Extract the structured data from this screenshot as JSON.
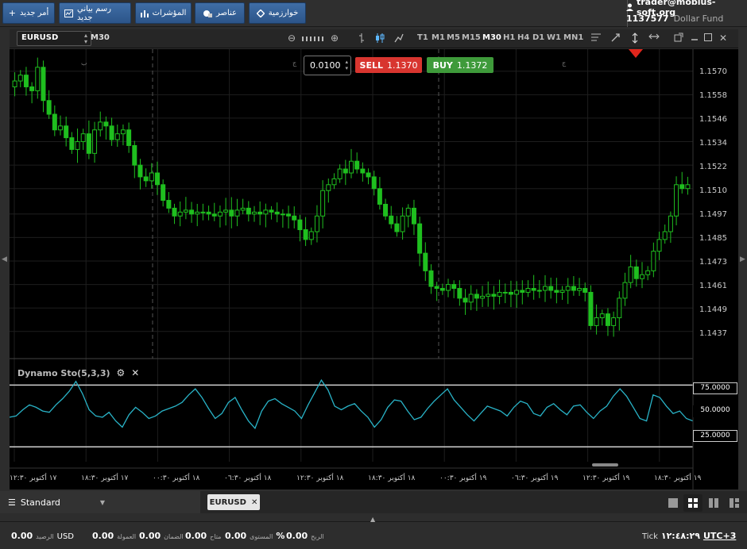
{
  "toolbar": {
    "new_order": "أمر جديد",
    "new_chart": "رسم بياني جديد",
    "indicators": "المؤشرات",
    "elements": "عناصر",
    "algorithm": "خوارزمية"
  },
  "account": {
    "user": "trader@mobius-soft.org",
    "number": "1137577",
    "fund": "Dollar Fund"
  },
  "chart_toolbar": {
    "symbol": "EURUSD",
    "timeframe": "M30",
    "timeframes": [
      "T1",
      "M1",
      "M5",
      "M15",
      "M30",
      "H1",
      "H4",
      "D1",
      "W1",
      "MN1"
    ],
    "active_timeframe": "M30"
  },
  "trade": {
    "lot": "0.0100",
    "sell_label": "SELL",
    "sell_price": "1.1370",
    "buy_label": "BUY",
    "buy_price": "1.1372"
  },
  "indicator": {
    "name": "Dynamo Sto(5,3,3)"
  },
  "price_axis": [
    "1.1570",
    "1.1558",
    "1.1546",
    "1.1534",
    "1.1522",
    "1.1510",
    "1.1497",
    "1.1485",
    "1.1473",
    "1.1461",
    "1.1449",
    "1.1437"
  ],
  "stoch_axis": [
    "75.0000",
    "50.0000",
    "25.0000"
  ],
  "session_markers": [
    "ب",
    "ج",
    "ج"
  ],
  "date_axis": [
    "١٧ أكتوبر ١٢:٣٠",
    "١٧ أكتوبر ١٨:٣٠",
    "١٨ أكتوبر ٠٠:٣٠",
    "١٨ أكتوبر ٠٦:٣٠",
    "١٨ أكتوبر ١٢:٣٠",
    "١٨ أكتوبر ١٨:٣٠",
    "١٩ أكتوبر ٠٠:٣٠",
    "١٩ أكتوبر ٠٦:٣٠",
    "١٩ أكتوبر ١٢:٣٠",
    "١٩ أكتوبر ١٨:٣٠"
  ],
  "bottom_tabs": {
    "template": "Standard",
    "chart_tab": "EURUSD"
  },
  "status": {
    "balance_value": "0.00",
    "balance_currency": "USD",
    "balance_label": "الرصيد",
    "commission_value": "0.00",
    "commission_label": "العمولة",
    "margin_value": "0.00",
    "margin_label": "الضمان",
    "available_value": "0.00",
    "available_label": "متاح",
    "level_value": "%",
    "level_label": "المستوى",
    "profit_value": "0.00",
    "profit_label": "الربح",
    "tick_label": "Tick",
    "time": "١٢:٤٨:٢٩",
    "timezone": "UTC+3"
  },
  "chart_data": {
    "type": "candlestick",
    "symbol": "EURUSD",
    "timeframe": "M30",
    "ylim": [
      1.1428,
      1.1578
    ],
    "closes": [
      1.1565,
      1.1568,
      1.1562,
      1.156,
      1.1572,
      1.1555,
      1.1548,
      1.154,
      1.1542,
      1.1536,
      1.153,
      1.1534,
      1.1538,
      1.1528,
      1.154,
      1.1544,
      1.1542,
      1.1535,
      1.1538,
      1.154,
      1.1532,
      1.1522,
      1.1516,
      1.1514,
      1.1518,
      1.1512,
      1.1504,
      1.15,
      1.1496,
      1.1498,
      1.1499,
      1.1497,
      1.1498,
      1.1498,
      1.1497,
      1.1496,
      1.1498,
      1.1499,
      1.1496,
      1.1499,
      1.15,
      1.1497,
      1.1498,
      1.1497,
      1.1499,
      1.1498,
      1.1497,
      1.1497,
      1.1496,
      1.1494,
      1.1489,
      1.1484,
      1.1488,
      1.1496,
      1.1509,
      1.1512,
      1.1515,
      1.152,
      1.1518,
      1.1524,
      1.152,
      1.1518,
      1.1516,
      1.151,
      1.1502,
      1.1496,
      1.1492,
      1.1488,
      1.1496,
      1.15,
      1.1492,
      1.1477,
      1.1468,
      1.146,
      1.1459,
      1.1458,
      1.1461,
      1.1459,
      1.1454,
      1.1452,
      1.1456,
      1.1454,
      1.1455,
      1.1456,
      1.1455,
      1.1457,
      1.1457,
      1.1456,
      1.1458,
      1.1457,
      1.1459,
      1.1458,
      1.1458,
      1.146,
      1.1458,
      1.1457,
      1.1458,
      1.146,
      1.1458,
      1.1459,
      1.1457,
      1.144,
      1.1444,
      1.1446,
      1.144,
      1.1444,
      1.1454,
      1.1462,
      1.147,
      1.1464,
      1.1466,
      1.1468,
      1.1478,
      1.1484,
      1.1488,
      1.1496,
      1.1512,
      1.151,
      1.1512
    ],
    "stochastic": [
      49,
      50,
      55,
      59,
      57,
      54,
      53,
      59,
      64,
      70,
      78,
      68,
      55,
      50,
      49,
      53,
      46,
      41,
      51,
      57,
      53,
      48,
      50,
      54,
      56,
      58,
      61,
      67,
      72,
      65,
      56,
      48,
      52,
      61,
      65,
      55,
      46,
      40,
      54,
      62,
      64,
      60,
      57,
      54,
      48,
      59,
      69,
      79,
      71,
      58,
      55,
      58,
      60,
      54,
      49,
      41,
      47,
      57,
      63,
      62,
      54,
      47,
      49,
      56,
      62,
      67,
      72,
      63,
      57,
      51,
      46,
      52,
      58,
      56,
      54,
      50,
      57,
      62,
      60,
      52,
      50,
      57,
      60,
      55,
      51,
      58,
      59,
      53,
      48,
      54,
      58,
      66,
      72,
      66,
      57,
      48,
      46,
      67,
      65,
      58,
      52,
      54,
      48,
      46
    ],
    "stoch_levels": [
      75,
      25
    ],
    "stoch_ylim": [
      13,
      90
    ],
    "grid": true
  }
}
